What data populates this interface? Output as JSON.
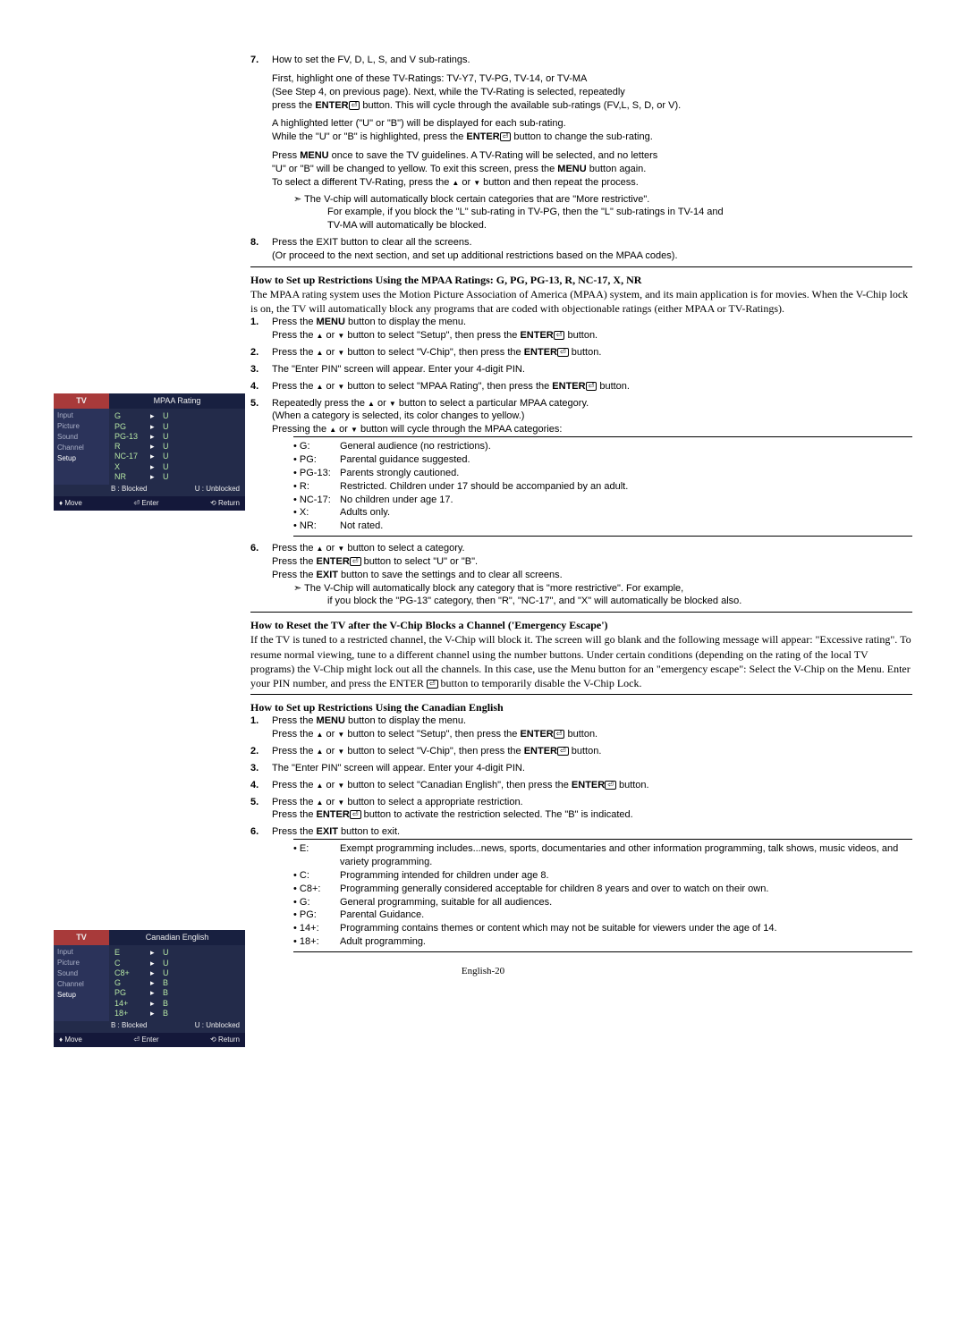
{
  "step7": {
    "num": "7.",
    "title": "How to set the FV, D, L, S, and V sub-ratings.",
    "p1a": "First, highlight one of these TV-Ratings: TV-Y7, TV-PG, TV-14, or TV-MA",
    "p1b": "(See Step 4, on previous page). Next, while the TV-Rating is selected, repeatedly",
    "p1c_a": "press the ",
    "p1c_b": "ENTER",
    "p1c_c": " button. This will cycle through the available sub-ratings (FV,L, S, D, or V).",
    "p2a": "A highlighted letter (\"U\" or \"B\") will be displayed for each sub-rating.",
    "p2b_a": "While the \"U\" or \"B\" is highlighted, press the ",
    "p2b_b": "ENTER",
    "p2b_c": " button to change the sub-rating.",
    "p3a_a": "Press ",
    "p3a_b": "MENU",
    "p3a_c": " once to save the TV guidelines. A TV-Rating will be selected, and no letters",
    "p3b_a": "\"U\" or \"B\" will be changed to yellow. To exit this screen, press the ",
    "p3b_b": "MENU",
    "p3b_c": " button again.",
    "p3c_a": "To select a different TV-Rating, press the ",
    "p3c_b": " or ",
    "p3c_c": " button and then repeat the process.",
    "bul1": "The V-chip will automatically block certain categories that are \"More restrictive\".",
    "bul2": "For example, if you block the \"L\" sub-rating in TV-PG, then the \"L\" sub-ratings in TV-14  and",
    "bul3": "TV-MA will automatically be blocked."
  },
  "step8": {
    "num": "8.",
    "l1": "Press the EXIT button to clear all the screens.",
    "l2": "(Or proceed to the next section, and set up additional restrictions based on the MPAA codes)."
  },
  "mpaa": {
    "heading": "How to Set up Restrictions Using the MPAA Ratings: G, PG, PG-13, R, NC-17, X, NR",
    "intro": "The MPAA rating system uses the Motion Picture Association of America (MPAA) system, and its main application is for movies. When the V-Chip lock is on, the TV will automatically block any programs that are coded with objectionable ratings (either MPAA or TV-Ratings).",
    "s1n": "1.",
    "s1a_a": "Press the ",
    "s1a_b": "MENU",
    "s1a_c": " button to display the menu.",
    "s1b_a": "Press the ",
    "s1b_b": " or ",
    "s1b_c": " button to select \"Setup\", then press the ",
    "s1b_d": "ENTER",
    "s1b_e": " button.",
    "s2n": "2.",
    "s2_a": "Press the ",
    "s2_b": " or ",
    "s2_c": " button to select \"V-Chip\", then press the ",
    "s2_d": "ENTER",
    "s2_e": " button.",
    "s3n": "3.",
    "s3": "The \"Enter PIN\" screen will appear. Enter your 4-digit PIN.",
    "s4n": "4.",
    "s4_a": "Press the ",
    "s4_b": " or ",
    "s4_c": " button to select \"MPAA Rating\", then press the ",
    "s4_d": "ENTER",
    "s4_e": " button.",
    "s5n": "5.",
    "s5a_a": "Repeatedly press the ",
    "s5a_b": " or ",
    "s5a_c": " button to select a particular MPAA category.",
    "s5b": "(When a category is selected, its color changes to yellow.)",
    "s5c_a": "Pressing the ",
    "s5c_b": " or ",
    "s5c_c": " button will cycle through the MPAA categories:",
    "s6n": "6.",
    "s6a_a": "Press the ",
    "s6a_b": " or ",
    "s6a_c": " button to select a category.",
    "s6b_a": "Press the ",
    "s6b_b": "ENTER",
    "s6b_c": " button to select \"U\" or \"B\".",
    "s6c_a": "Press the ",
    "s6c_b": "EXIT",
    "s6c_c": " button to save the settings and to clear all screens.",
    "s6d": "The V-Chip will automatically block any category that is \"more restrictive\". For example,",
    "s6e": "if you block the \"PG-13\" category, then \"R\", \"NC-17\", and \"X\" will automatically be blocked also."
  },
  "mpaa_defs": [
    {
      "k": "• G:",
      "v": "General audience (no restrictions)."
    },
    {
      "k": "• PG:",
      "v": "Parental guidance suggested."
    },
    {
      "k": "• PG-13:",
      "v": "Parents strongly cautioned."
    },
    {
      "k": "• R:",
      "v": "Restricted. Children under 17 should be accompanied by an adult."
    },
    {
      "k": "• NC-17:",
      "v": "No children under age 17."
    },
    {
      "k": "• X:",
      "v": "Adults only."
    },
    {
      "k": "• NR:",
      "v": "Not rated."
    }
  ],
  "reset": {
    "heading": "How to Reset the TV after the V-Chip Blocks a Channel ('Emergency Escape')",
    "p_a": "If the TV is tuned to a restricted channel, the V-Chip will block it. The screen will go blank and the following message will appear: \"Excessive rating\". To resume normal viewing, tune to a different channel using the number buttons. Under certain conditions (depending on the rating of the local TV programs) the V-Chip might lock out all the channels. In this case, use the Menu button for an \"emergency escape\": Select the V-Chip on the Menu. Enter your PIN number, and press the ENTER ",
    "p_b": " button to temporarily disable the V-Chip Lock."
  },
  "ceng": {
    "heading": "How to Set up Restrictions Using the Canadian English",
    "s1n": "1.",
    "s1a_a": "Press the ",
    "s1a_b": "MENU",
    "s1a_c": " button to display the menu.",
    "s1b_a": "Press the ",
    "s1b_b": " or ",
    "s1b_c": " button to select \"Setup\", then press the ",
    "s1b_d": "ENTER",
    "s1b_e": " button.",
    "s2n": "2.",
    "s2_a": "Press the ",
    "s2_b": " or ",
    "s2_c": " button to select \"V-Chip\", then press the ",
    "s2_d": "ENTER",
    "s2_e": " button.",
    "s3n": "3.",
    "s3": "The \"Enter PIN\" screen will appear. Enter your 4-digit PIN.",
    "s4n": "4.",
    "s4_a": "Press the ",
    "s4_b": " or ",
    "s4_c": " button to select \"Canadian English\", then press the ",
    "s4_d": "ENTER",
    "s4_e": " button.",
    "s5n": "5.",
    "s5a_a": "Press the ",
    "s5a_b": " or ",
    "s5a_c": " button to select a appropriate restriction.",
    "s5b_a": "Press the ",
    "s5b_b": "ENTER",
    "s5b_c": " button to activate the restriction selected. The \"B\" is indicated.",
    "s6n": "6.",
    "s6_a": "Press the ",
    "s6_b": "EXIT",
    "s6_c": " button to exit."
  },
  "ceng_defs": [
    {
      "k": "• E:",
      "v": "Exempt programming includes...news, sports, documentaries and other information programming, talk shows, music videos, and variety programming."
    },
    {
      "k": "• C:",
      "v": "Programming intended for children under age 8."
    },
    {
      "k": "• C8+:",
      "v": "Programming generally considered acceptable for children 8 years and over to watch on their own."
    },
    {
      "k": "• G:",
      "v": "General programming, suitable for all audiences."
    },
    {
      "k": "• PG:",
      "v": "Parental Guidance."
    },
    {
      "k": "• 14+:",
      "v": "Programming contains themes or content which may not be suitable for viewers under the age of 14."
    },
    {
      "k": "• 18+:",
      "v": "Adult programming."
    }
  ],
  "osd1": {
    "tv": "TV",
    "title": "MPAA Rating",
    "menu": [
      "Input",
      "Picture",
      "Sound",
      "Channel",
      "Setup"
    ],
    "rows": [
      [
        "G",
        "▸",
        "U"
      ],
      [
        "PG",
        "▸",
        "U"
      ],
      [
        "PG-13",
        "▸",
        "U"
      ],
      [
        "R",
        "▸",
        "U"
      ],
      [
        "NC-17",
        "▸",
        "U"
      ],
      [
        "X",
        "▸",
        "U"
      ],
      [
        "NR",
        "▸",
        "U"
      ]
    ],
    "blk": "B : Blocked",
    "unb": "U : Unblocked",
    "move": "Move",
    "enter": "Enter",
    "return": "Return"
  },
  "osd2": {
    "tv": "TV",
    "title": "Canadian English",
    "menu": [
      "Input",
      "Picture",
      "Sound",
      "Channel",
      "Setup"
    ],
    "rows": [
      [
        "E",
        "▸",
        "U"
      ],
      [
        "C",
        "▸",
        "U"
      ],
      [
        "C8+",
        "▸",
        "U"
      ],
      [
        "G",
        "▸",
        "B"
      ],
      [
        "PG",
        "▸",
        "B"
      ],
      [
        "14+",
        "▸",
        "B"
      ],
      [
        "18+",
        "▸",
        "B"
      ]
    ],
    "blk": "B : Blocked",
    "unb": "U : Unblocked",
    "move": "Move",
    "enter": "Enter",
    "return": "Return"
  },
  "page": "English-20"
}
